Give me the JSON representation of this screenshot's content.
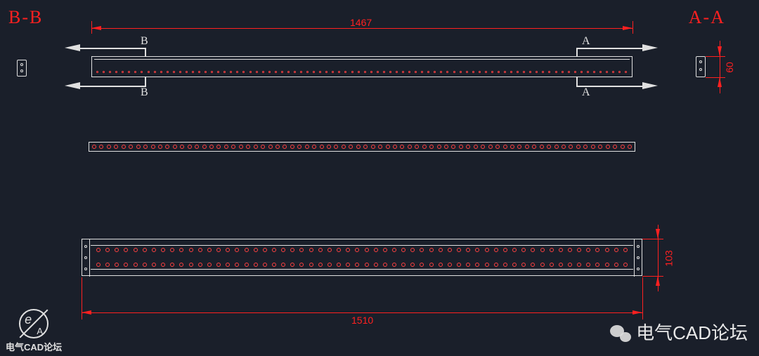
{
  "sections": {
    "left_label": "B-B",
    "right_label": "A-A",
    "cut_B_top": "B",
    "cut_B_bot": "B",
    "cut_A_top": "A",
    "cut_A_bot": "A"
  },
  "dimensions": {
    "top_width": "1467",
    "right_height_small": "60",
    "right_height_big": "103",
    "bottom_width": "1510"
  },
  "logo": {
    "bottom_left_text": "电气CAD论坛",
    "e": "e",
    "a": "A"
  },
  "watermark": {
    "text": "电气CAD论坛"
  },
  "chart_data": {
    "type": "diagram",
    "description": "CAD mechanical/electrical drawing with orthographic views and two section call-outs",
    "views": [
      {
        "name": "top-plan-view",
        "width_mm": 1467,
        "height_mm": 60,
        "section_cuts": [
          "B-B",
          "A-A"
        ],
        "hole_rows": 1
      },
      {
        "name": "mid-strip-view",
        "hole_rows": 1
      },
      {
        "name": "bottom-front-view",
        "width_mm": 1510,
        "height_mm": 103,
        "hole_rows": 2
      },
      {
        "name": "section-B-B",
        "position": "left-side-block"
      },
      {
        "name": "section-A-A",
        "position": "right-side-block",
        "height_mm": 60
      }
    ],
    "units": "mm"
  }
}
